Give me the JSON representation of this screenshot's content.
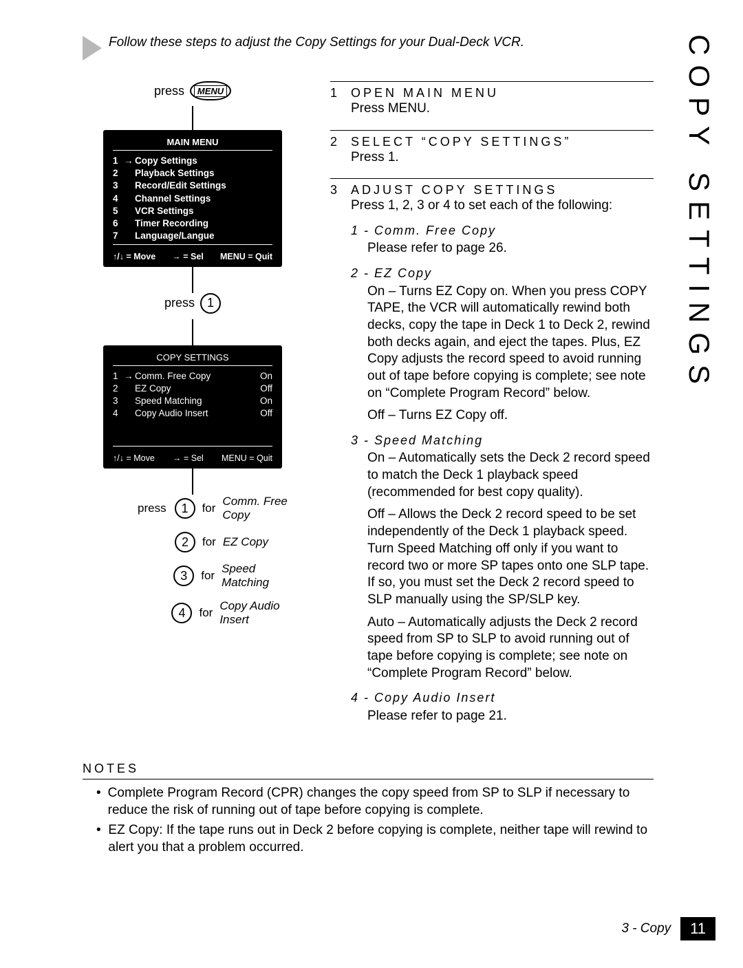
{
  "intro": "Follow these steps to adjust the Copy Settings for your Dual-Deck VCR.",
  "press_label": "press",
  "menu_button": "MENU",
  "for_label": "for",
  "main_menu": {
    "title": "MAIN MENU",
    "items": [
      {
        "n": "1",
        "label": "Copy Settings",
        "sel": true
      },
      {
        "n": "2",
        "label": "Playback Settings"
      },
      {
        "n": "3",
        "label": "Record/Edit Settings"
      },
      {
        "n": "4",
        "label": "Channel Settings"
      },
      {
        "n": "5",
        "label": "VCR Settings"
      },
      {
        "n": "6",
        "label": "Timer Recording"
      },
      {
        "n": "7",
        "label": "Language/Langue"
      }
    ],
    "foot_move": "↑/↓ = Move",
    "foot_sel": "→ = Sel",
    "foot_quit": "MENU = Quit"
  },
  "copy_menu": {
    "title": "COPY SETTINGS",
    "items": [
      {
        "n": "1",
        "label": "Comm. Free Copy",
        "val": "On",
        "sel": true
      },
      {
        "n": "2",
        "label": "EZ Copy",
        "val": "Off"
      },
      {
        "n": "3",
        "label": "Speed Matching",
        "val": "On"
      },
      {
        "n": "4",
        "label": "Copy Audio Insert",
        "val": "Off"
      }
    ],
    "foot_move": "↑/↓ = Move",
    "foot_sel": "→ = Sel",
    "foot_quit": "MENU = Quit"
  },
  "option_buttons": [
    {
      "n": "1",
      "label": "Comm. Free Copy"
    },
    {
      "n": "2",
      "label": "EZ Copy"
    },
    {
      "n": "3",
      "label": "Speed Matching"
    },
    {
      "n": "4",
      "label": "Copy Audio Insert"
    }
  ],
  "steps": {
    "s1": {
      "num": "1",
      "title": "OPEN MAIN MENU",
      "body": "Press MENU."
    },
    "s2": {
      "num": "2",
      "title": "SELECT “COPY SETTINGS”",
      "body": "Press 1."
    },
    "s3": {
      "num": "3",
      "title": "ADJUST COPY SETTINGS",
      "body": "Press 1, 2, 3 or 4 to set each of the following:",
      "subs": {
        "a": {
          "head": "1 - Comm. Free Copy",
          "p1": "Please refer to page 26."
        },
        "b": {
          "head": "2 - EZ Copy",
          "p1": "On – Turns EZ Copy on. When you press COPY TAPE, the VCR will automatically rewind both decks, copy the tape in Deck 1 to Deck 2, rewind both decks again, and eject the tapes. Plus, EZ Copy adjusts the record speed to avoid running out of tape before copying is complete; see note on “Complete Program Record” below.",
          "p2": "Off – Turns EZ Copy off."
        },
        "c": {
          "head": "3 - Speed Matching",
          "p1": "On – Automatically sets the Deck 2 record speed to match the Deck 1 playback speed (recommended for best copy quality).",
          "p2": "Off – Allows the Deck 2 record speed to be set independently of the Deck 1 playback speed. Turn Speed Matching off only if you want to record two or more SP tapes onto one SLP tape. If so, you must set the Deck 2 record speed to SLP manually using the SP/SLP key.",
          "p3": "Auto – Automatically adjusts the Deck 2 record speed from SP to SLP to avoid running out of tape before copying is complete; see note on “Complete Program Record” below."
        },
        "d": {
          "head": "4 - Copy Audio Insert",
          "p1": "Please refer to page 21."
        }
      }
    }
  },
  "notes": {
    "title": "NOTES",
    "items": [
      "Complete Program Record (CPR) changes the copy speed from SP to SLP if necessary to reduce the risk of running out of tape before copying is complete.",
      "EZ Copy: If the tape runs out in Deck 2 before copying is complete, neither tape will rewind to alert you that a problem occurred."
    ]
  },
  "side_title": "COPY SETTINGS",
  "footer": {
    "chapter": "3 - Copy",
    "page": "11"
  }
}
